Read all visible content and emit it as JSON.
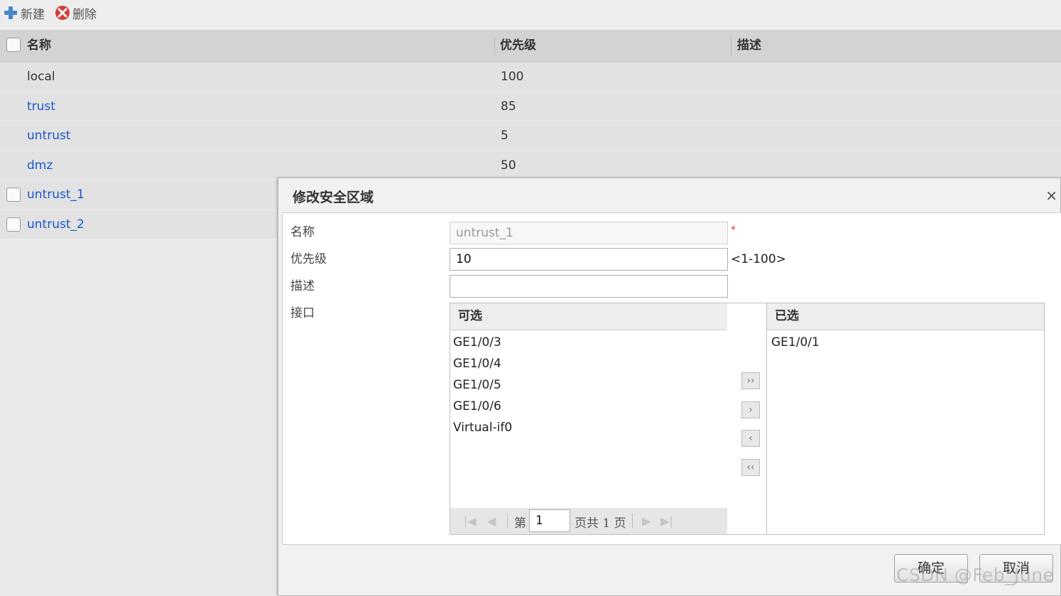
{
  "toolbar": {
    "new_label": "新建",
    "delete_label": "删除"
  },
  "table": {
    "headers": {
      "name": "名称",
      "priority": "优先级",
      "desc": "描述"
    },
    "rows": [
      {
        "name": "local",
        "priority": "100"
      },
      {
        "name": "trust",
        "priority": "85"
      },
      {
        "name": "untrust",
        "priority": "5"
      },
      {
        "name": "dmz",
        "priority": "50"
      },
      {
        "name": "untrust_1",
        "priority": ""
      },
      {
        "name": "untrust_2",
        "priority": ""
      }
    ]
  },
  "dialog": {
    "title": "修改安全区域",
    "close_icon": "×",
    "labels": {
      "name": "名称",
      "priority": "优先级",
      "desc": "描述",
      "interface": "接口"
    },
    "name_value": "untrust_1",
    "required_mark": "*",
    "priority_value": "10",
    "priority_range": "<1-100>",
    "desc_value": "",
    "available": {
      "header": "可选",
      "items": [
        "GE1/0/3",
        "GE1/0/4",
        "GE1/0/5",
        "GE1/0/6",
        "Virtual-if0"
      ]
    },
    "selected": {
      "header": "已选",
      "items": [
        "GE1/0/1"
      ]
    },
    "pager": {
      "prefix": "第",
      "page": "1",
      "suffix": "页共 1 页"
    },
    "ok_label": "确定",
    "cancel_label": "取消"
  },
  "watermark": "CSDN @Feb_June"
}
